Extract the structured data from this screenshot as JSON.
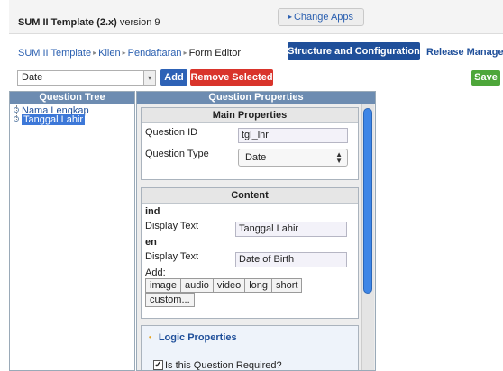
{
  "header": {
    "app_title_bold": "SUM II Template (2.x)",
    "app_title_rest": " version 9",
    "change_apps": "Change Apps"
  },
  "breadcrumb": {
    "items": [
      "SUM II Template",
      "Klien",
      "Pendaftaran",
      "Form Editor"
    ]
  },
  "tabs": {
    "structure": "Structure and Configuration",
    "release": "Release Manager"
  },
  "toolbar": {
    "question_type_value": "Date",
    "add_label": "Add",
    "remove_label": "Remove Selected",
    "save_label": "Save"
  },
  "tree": {
    "title": "Question Tree",
    "items": [
      "Nama Lengkap",
      "Tanggal Lahir"
    ]
  },
  "properties": {
    "title": "Question Properties",
    "main": {
      "title": "Main Properties",
      "id_label": "Question ID",
      "id_value": "tgl_lhr",
      "type_label": "Question Type",
      "type_value": "Date"
    },
    "content": {
      "title": "Content",
      "lang1": "ind",
      "lang1_label": "Display Text",
      "lang1_value": "Tanggal Lahir",
      "lang2": "en",
      "lang2_label": "Display Text",
      "lang2_value": "Date of Birth",
      "add_label": "Add:",
      "media": [
        "image",
        "audio",
        "video",
        "long",
        "short",
        "custom..."
      ]
    },
    "logic": {
      "title": "Logic Properties",
      "required_label": "Is this Question Required?"
    }
  },
  "colors": {
    "primary_blue": "#1f4f9a",
    "add_blue": "#2d62b6",
    "remove_red": "#d9342b",
    "save_green": "#4da63a",
    "panel_header": "#6d8cb1"
  }
}
